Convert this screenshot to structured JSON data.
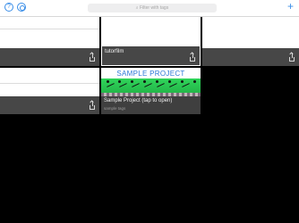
{
  "toolbar": {
    "help_icon": "question-circle-icon",
    "settings_icon": "settings-icon",
    "search_placeholder": "Filter with tags",
    "add_icon": "plus-icon",
    "accent_color": "#3a8ee8"
  },
  "projects": [
    {
      "title": "",
      "subtitle": ""
    },
    {
      "title": "tutorfilm",
      "subtitle": ""
    },
    {
      "title": "",
      "subtitle": ""
    },
    {
      "title": "",
      "subtitle": ""
    },
    {
      "title": "Sample Project (tap to open)",
      "subtitle": "sample tags",
      "thumbnail_title": "SAMPLE PROJECT"
    }
  ],
  "colors": {
    "background": "#000000",
    "tile_bar": "#474747",
    "thumbnail_green": "#2fd45a",
    "thumbnail_title": "#2c78d6"
  }
}
